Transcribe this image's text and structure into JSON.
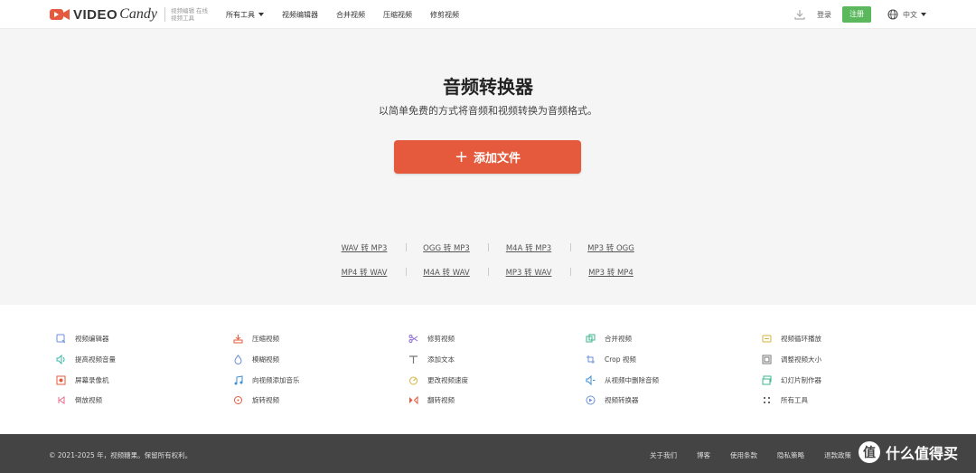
{
  "header": {
    "logo_video": "VIDEO",
    "logo_candy": "Candy",
    "logo_tag": "视频编辑 在线视频工具",
    "nav": [
      {
        "label": "所有工具",
        "dropdown": true
      },
      {
        "label": "视频编辑器"
      },
      {
        "label": "合并视频"
      },
      {
        "label": "压缩视频"
      },
      {
        "label": "修剪视频"
      }
    ],
    "login": "登录",
    "signup": "注册",
    "language": "中文"
  },
  "hero": {
    "title": "音频转换器",
    "subtitle": "以简单免费的方式将音频和视频转换为音频格式。",
    "add_button": "添加文件",
    "conversions_row1": [
      "WAV 转 MP3",
      "OGG 转 MP3",
      "M4A 转 MP3",
      "MP3 转 OGG"
    ],
    "conversions_row2": [
      "MP4 转 WAV",
      "M4A 转 WAV",
      "MP3 转 WAV",
      "MP3 转 MP4"
    ]
  },
  "tools": [
    [
      {
        "label": "视频编辑器",
        "icon": "video-editor-icon"
      },
      {
        "label": "提高视频音量",
        "icon": "volume-icon"
      },
      {
        "label": "屏幕录像机",
        "icon": "screen-recorder-icon"
      },
      {
        "label": "倒放视频",
        "icon": "reverse-icon"
      }
    ],
    [
      {
        "label": "压缩视频",
        "icon": "compress-icon"
      },
      {
        "label": "模糊视频",
        "icon": "blur-icon"
      },
      {
        "label": "向视频添加音乐",
        "icon": "music-icon"
      },
      {
        "label": "旋转视频",
        "icon": "rotate-icon"
      }
    ],
    [
      {
        "label": "修剪视频",
        "icon": "scissors-icon"
      },
      {
        "label": "添加文本",
        "icon": "text-icon"
      },
      {
        "label": "更改视频速度",
        "icon": "speed-icon"
      },
      {
        "label": "翻转视频",
        "icon": "flip-icon"
      }
    ],
    [
      {
        "label": "合并视频",
        "icon": "merge-icon"
      },
      {
        "label": "Crop 视频",
        "icon": "crop-icon"
      },
      {
        "label": "从视频中删除音频",
        "icon": "mute-icon"
      },
      {
        "label": "视频转换器",
        "icon": "converter-icon"
      }
    ],
    [
      {
        "label": "视频循环播放",
        "icon": "loop-icon"
      },
      {
        "label": "调整视频大小",
        "icon": "resize-icon"
      },
      {
        "label": "幻灯片制作器",
        "icon": "slideshow-icon"
      },
      {
        "label": "所有工具",
        "icon": "grid-icon"
      }
    ]
  ],
  "footer": {
    "copyright": "© 2021-2025 年，视频糖果。保留所有权利。",
    "links": [
      "关于我们",
      "博客",
      "使用条款",
      "隐私策略",
      "退款政策"
    ],
    "watermark_badge": "值",
    "watermark_text": "什么值得买"
  },
  "colors": {
    "accent": "#e55a3c",
    "signup": "#5cb85c",
    "footer_bg": "#444444",
    "hero_bg": "#f5f5f5"
  }
}
